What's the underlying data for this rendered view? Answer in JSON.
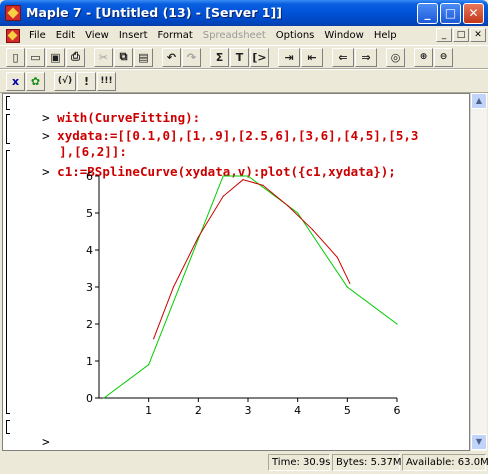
{
  "window": {
    "title": "Maple 7 - [Untitled (13) - [Server 1]]",
    "buttons": {
      "minimize": "_",
      "maximize": "□",
      "close": "✕"
    }
  },
  "menu": {
    "items": [
      {
        "label": "File",
        "disabled": false
      },
      {
        "label": "Edit",
        "disabled": false
      },
      {
        "label": "View",
        "disabled": false
      },
      {
        "label": "Insert",
        "disabled": false
      },
      {
        "label": "Format",
        "disabled": false
      },
      {
        "label": "Spreadsheet",
        "disabled": true
      },
      {
        "label": "Options",
        "disabled": false
      },
      {
        "label": "Window",
        "disabled": false
      },
      {
        "label": "Help",
        "disabled": false
      }
    ],
    "mdi_buttons": [
      "_",
      "□",
      "✕"
    ]
  },
  "toolbar1": {
    "buttons": [
      {
        "icon": "new-document-icon",
        "glyph": "▯"
      },
      {
        "icon": "open-icon",
        "glyph": "▭"
      },
      {
        "icon": "save-icon",
        "glyph": "▣"
      },
      {
        "icon": "print-icon",
        "glyph": "⎙"
      },
      {
        "icon": "cut-icon",
        "glyph": "✂"
      },
      {
        "icon": "copy-icon",
        "glyph": "⧉"
      },
      {
        "icon": "paste-icon",
        "glyph": "▤"
      },
      {
        "icon": "undo-icon",
        "glyph": "↶"
      },
      {
        "icon": "redo-icon",
        "glyph": "↷"
      },
      {
        "icon": "sigma-icon",
        "glyph": "Σ"
      },
      {
        "icon": "text-icon",
        "glyph": "T"
      },
      {
        "icon": "prompt-icon",
        "glyph": "[>"
      },
      {
        "icon": "indent-icon",
        "glyph": "⇥"
      },
      {
        "icon": "outdent-icon",
        "glyph": "⇤"
      },
      {
        "icon": "back-icon",
        "glyph": "⇐"
      },
      {
        "icon": "forward-icon",
        "glyph": "⇒"
      },
      {
        "icon": "stop-icon",
        "glyph": "◎"
      },
      {
        "icon": "zoom-in-icon",
        "glyph": "🔍"
      },
      {
        "icon": "zoom-out-icon",
        "glyph": "🔍"
      }
    ]
  },
  "toolbar2": {
    "buttons": [
      {
        "icon": "math-mode-icon",
        "glyph": "x"
      },
      {
        "icon": "maple-leaf-icon",
        "glyph": "✿"
      },
      {
        "icon": "check-syntax-icon",
        "glyph": "(√)"
      },
      {
        "icon": "execute-icon",
        "glyph": "!"
      },
      {
        "icon": "execute-all-icon",
        "glyph": "!!!"
      }
    ]
  },
  "worksheet": {
    "prompt": ">",
    "commands": [
      {
        "lines": [
          "with(CurveFitting):"
        ]
      },
      {
        "lines": [
          "xydata:=[[0.1,0],[1,.9],[2.5,6],[3,6],[4,5],[5,3",
          "],[6,2]]:"
        ]
      },
      {
        "lines": [
          "c1:=BSplineCurve(xydata,v):plot({c1,xydata});"
        ]
      }
    ],
    "empty_prompt": ">"
  },
  "chart_data": {
    "type": "line",
    "title": "",
    "xlabel": "",
    "ylabel": "",
    "xlim": [
      0,
      6
    ],
    "ylim": [
      0,
      6
    ],
    "x_ticks": [
      "1",
      "2",
      "3",
      "4",
      "5",
      "6"
    ],
    "y_ticks": [
      "0",
      "1",
      "2",
      "3",
      "4",
      "5",
      "6"
    ],
    "grid": false,
    "legend": "none",
    "series": [
      {
        "color": "#00cc00",
        "points": [
          [
            0.1,
            0
          ],
          [
            1,
            0.9
          ],
          [
            2.5,
            6
          ],
          [
            3,
            6
          ],
          [
            4,
            5
          ],
          [
            5,
            3
          ],
          [
            6,
            2
          ]
        ]
      },
      {
        "color": "#cc0000",
        "points": [
          [
            1.1,
            1.6
          ],
          [
            1.5,
            3.0
          ],
          [
            2.0,
            4.35
          ],
          [
            2.5,
            5.45
          ],
          [
            2.9,
            5.9
          ],
          [
            3.3,
            5.75
          ],
          [
            3.8,
            5.2
          ],
          [
            4.3,
            4.55
          ],
          [
            4.8,
            3.8
          ],
          [
            5.05,
            3.1
          ]
        ]
      }
    ]
  },
  "status": {
    "time": "Time: 30.9s",
    "bytes": "Bytes: 5.37M",
    "available": "Available: 63.0M"
  },
  "colors": {
    "code": "#cc0000",
    "curve_green": "#00cc00",
    "curve_red": "#cc0000"
  }
}
